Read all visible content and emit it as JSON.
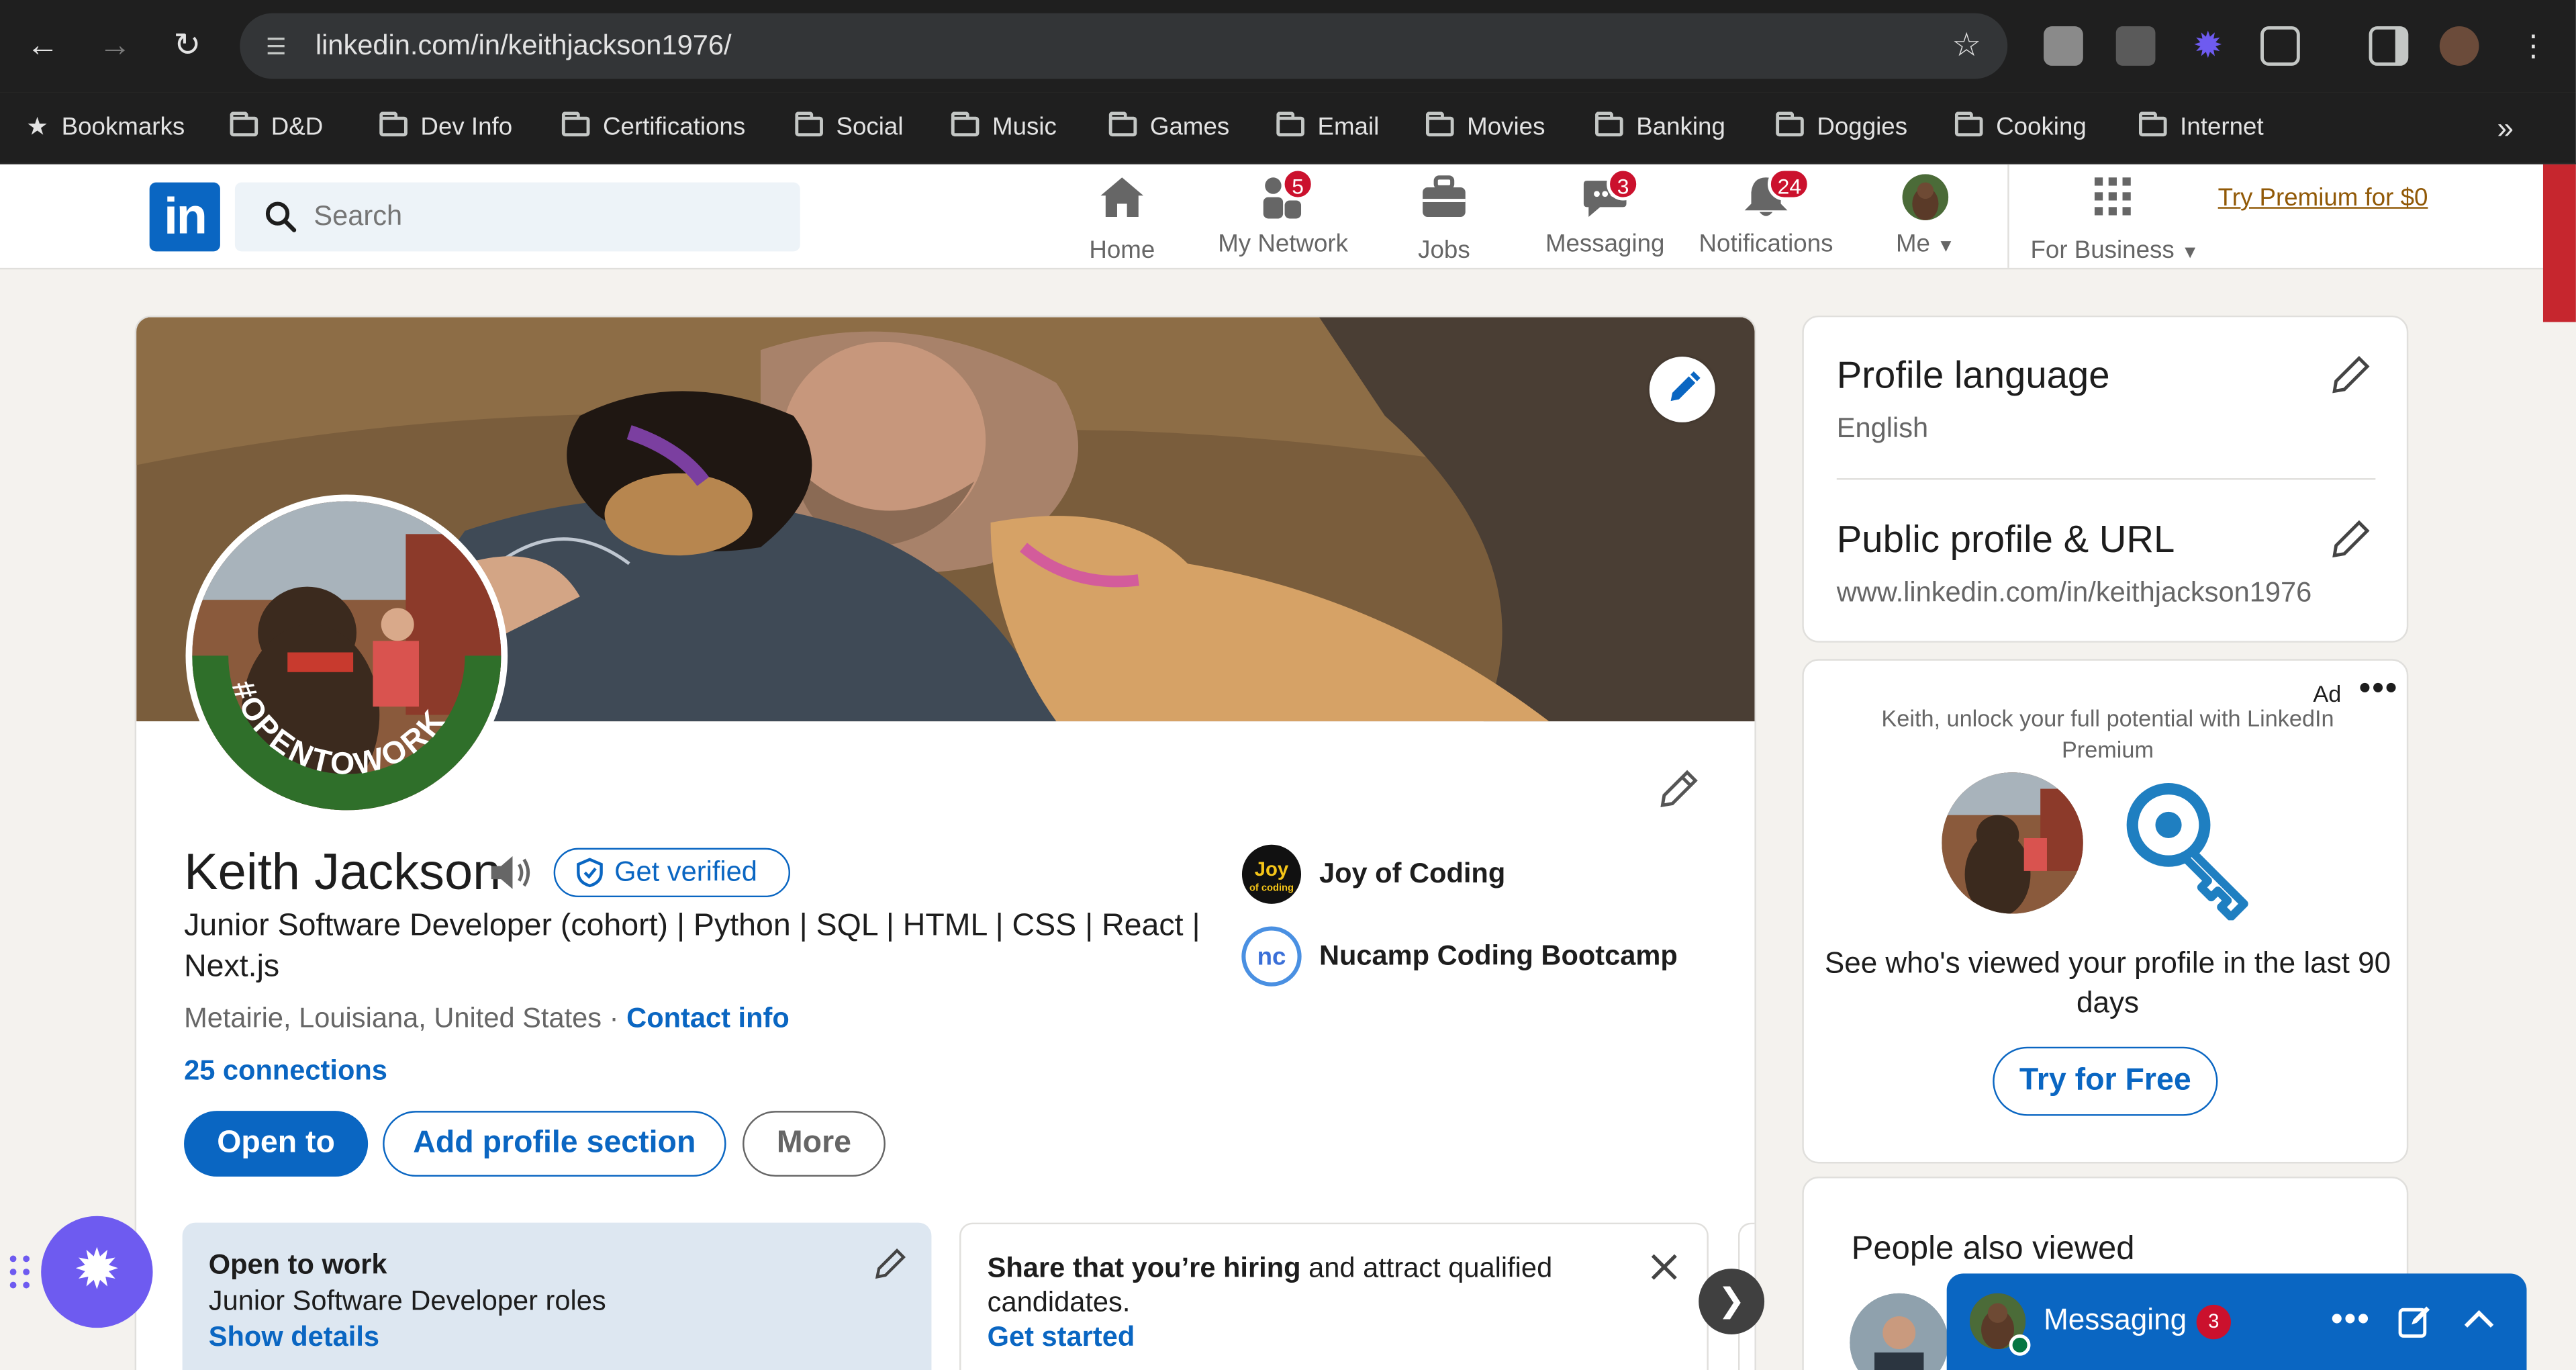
{
  "browser": {
    "url": "linkedin.com/in/keithjackson1976/",
    "bookmarks": [
      "Bookmarks",
      "D&D",
      "Dev Info",
      "Certifications",
      "Social",
      "Music",
      "Games",
      "Email",
      "Movies",
      "Banking",
      "Doggies",
      "Cooking",
      "Internet"
    ]
  },
  "nav": {
    "logo": "in",
    "search_placeholder": "Search",
    "items": [
      {
        "label": "Home",
        "badge": ""
      },
      {
        "label": "My Network",
        "badge": "5"
      },
      {
        "label": "Jobs",
        "badge": ""
      },
      {
        "label": "Messaging",
        "badge": "3"
      },
      {
        "label": "Notifications",
        "badge": "24"
      },
      {
        "label": "Me",
        "badge": ""
      },
      {
        "label": "For Business",
        "badge": ""
      }
    ],
    "premium": "Try Premium for $0"
  },
  "profile": {
    "frame_text": "#OPENTOWORK",
    "name": "Keith Jackson",
    "verify_label": "Get verified",
    "headline": "Junior Software Developer (cohort) | Python | SQL | HTML | CSS | React | Next.js",
    "location": "Metairie, Louisiana, United States",
    "separator": "·",
    "contact_label": "Contact info",
    "connections": "25 connections",
    "buttons": {
      "open_to": "Open to",
      "add_section": "Add profile section",
      "more": "More"
    },
    "orgs": [
      {
        "name": "Joy of Coding",
        "logo_text": "Joy of coding"
      },
      {
        "name": "Nucamp Coding Bootcamp",
        "logo_text": "nc"
      }
    ]
  },
  "open_to_work": {
    "title": "Open to work",
    "roles": "Junior Software Developer roles",
    "link": "Show details"
  },
  "hiring": {
    "bold": "Share that you’re hiring",
    "rest": " and attract qualified candidates.",
    "link": "Get started"
  },
  "right_rail": {
    "language_title": "Profile language",
    "language_value": "English",
    "url_title": "Public profile & URL",
    "url_value": "www.linkedin.com/in/keithjackson1976",
    "ad": {
      "label": "Ad",
      "copy": "Keith, unlock your full potential with LinkedIn Premium",
      "text": "See who's viewed your profile in the last 90 days",
      "button": "Try for Free"
    },
    "people_also_viewed": "People also viewed"
  },
  "messaging": {
    "label": "Messaging",
    "count": "3"
  },
  "colors": {
    "linkedin_blue": "#0a66c2",
    "badge_red": "#cb112d",
    "otw_green": "#2f6f2a",
    "premium_gold": "#915907"
  }
}
